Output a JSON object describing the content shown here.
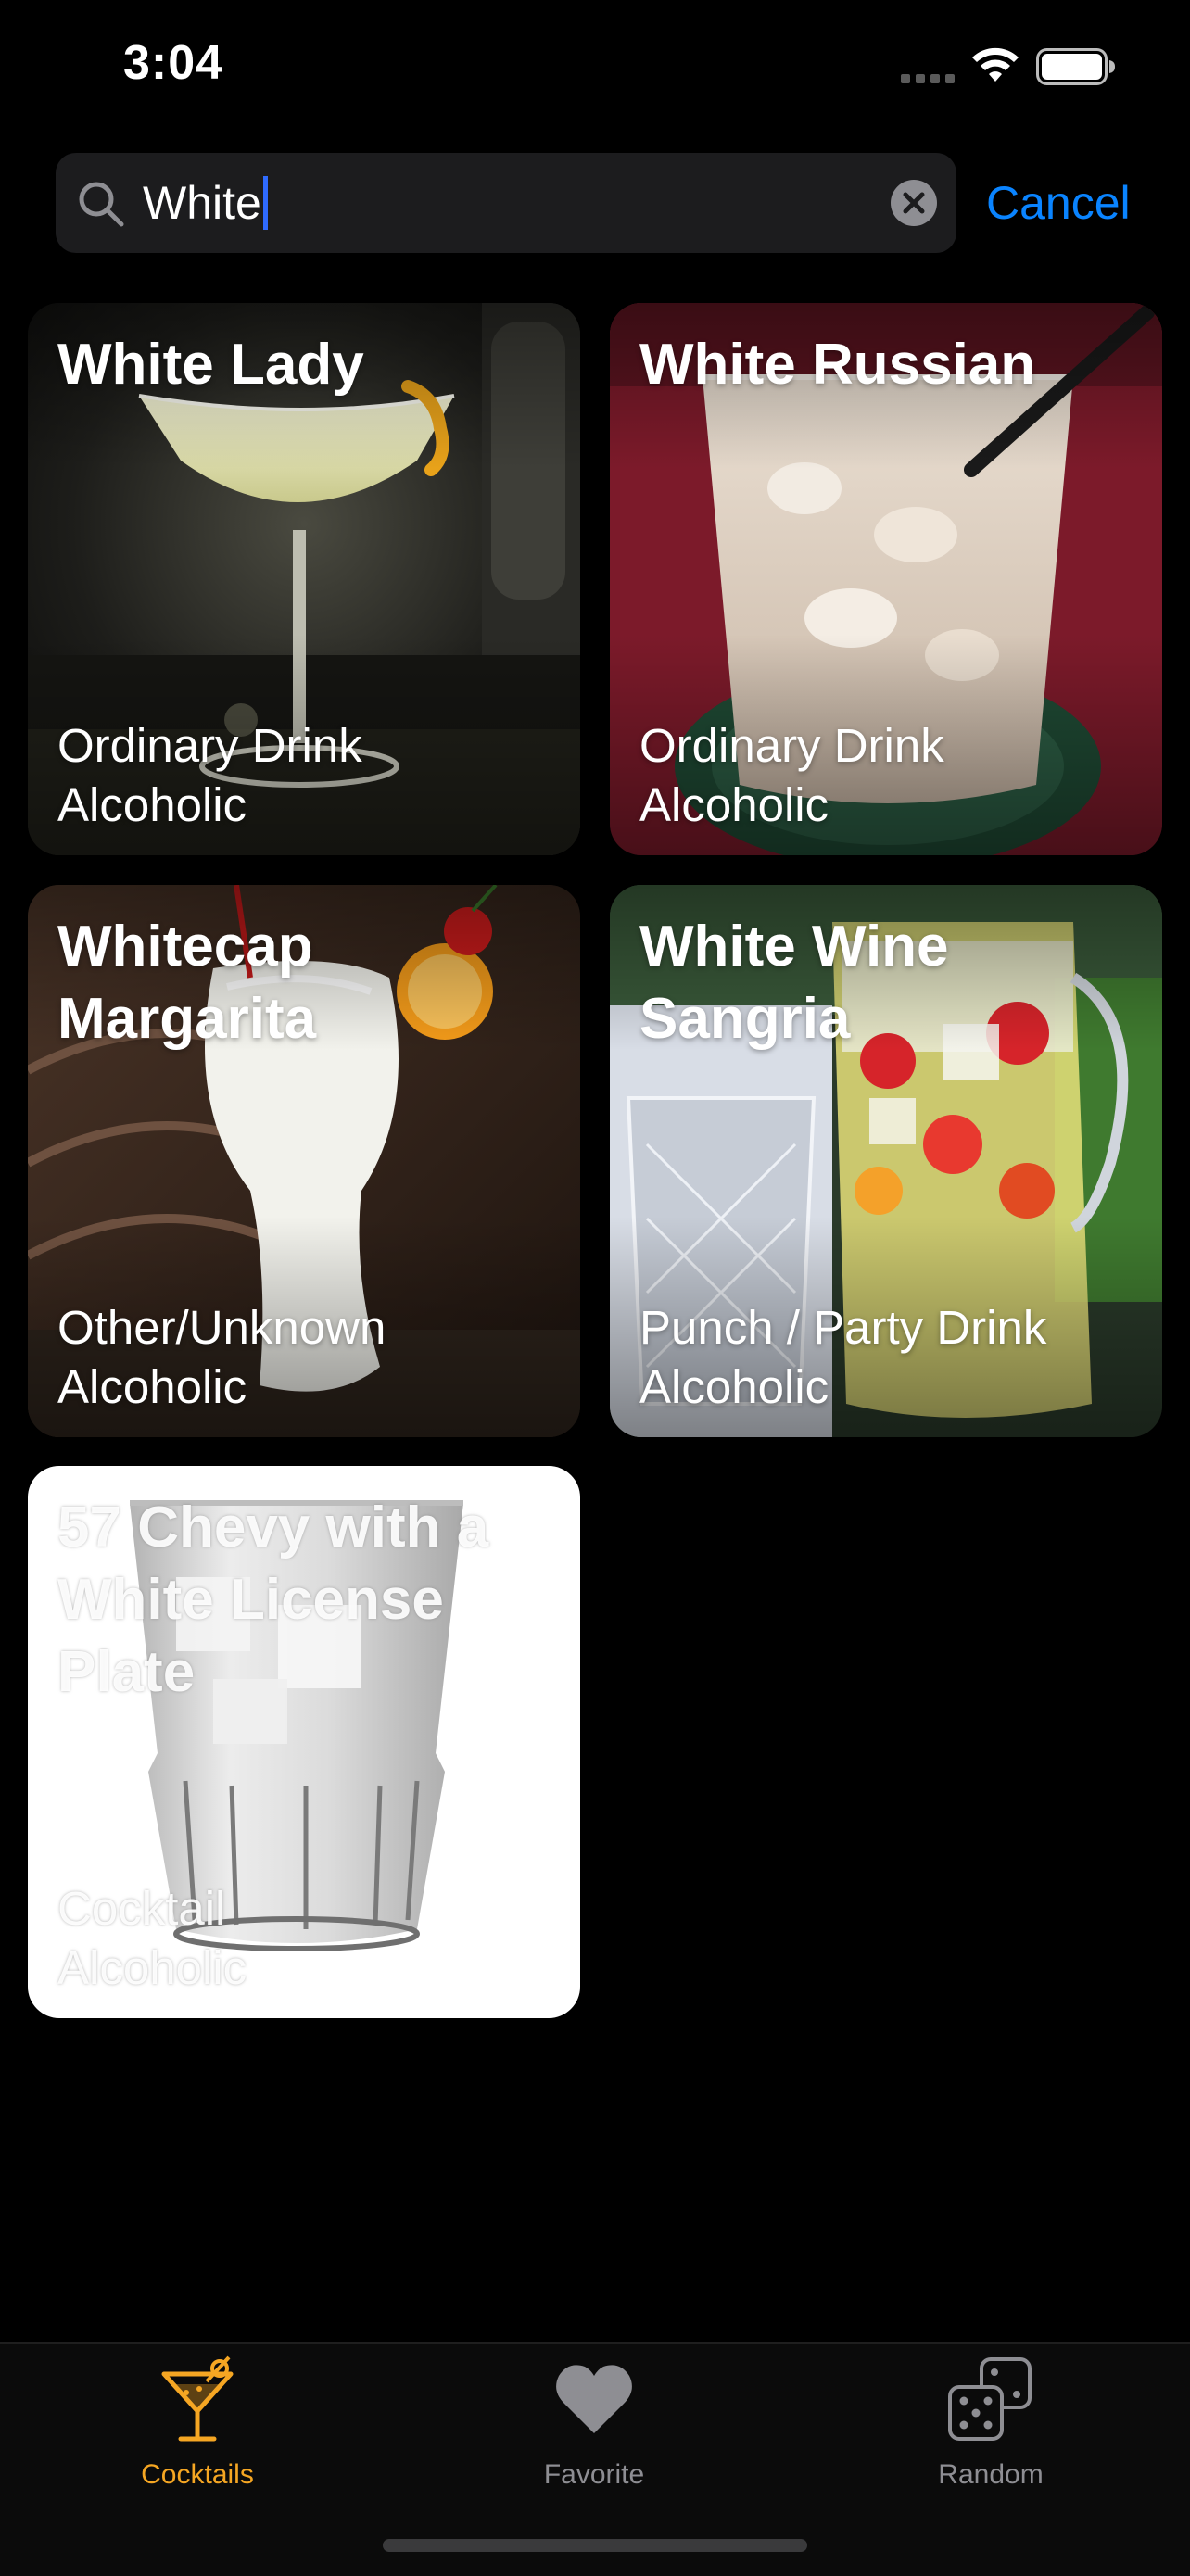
{
  "status_bar": {
    "time": "3:04"
  },
  "search": {
    "value": "White",
    "cancel_label": "Cancel",
    "accent_color": "#0a84ff",
    "caret_color": "#2f6bff"
  },
  "results": [
    {
      "title": "White Lady",
      "category": "Ordinary Drink",
      "alcoholic": "Alcoholic"
    },
    {
      "title": "White Russian",
      "category": "Ordinary Drink",
      "alcoholic": "Alcoholic"
    },
    {
      "title": "Whitecap Margarita",
      "category": "Other/Unknown",
      "alcoholic": "Alcoholic"
    },
    {
      "title": "White Wine Sangria",
      "category": "Punch / Party Drink",
      "alcoholic": "Alcoholic"
    },
    {
      "title": "57 Chevy with a White License Plate",
      "category": "Cocktail",
      "alcoholic": "Alcoholic"
    }
  ],
  "tab_bar": {
    "tabs": [
      {
        "label": "Cocktails",
        "icon": "cocktail-glass-icon",
        "active": true
      },
      {
        "label": "Favorite",
        "icon": "heart-icon",
        "active": false
      },
      {
        "label": "Random",
        "icon": "dice-icon",
        "active": false
      }
    ],
    "active_color": "#f5a623",
    "inactive_color": "#8e8e93"
  }
}
